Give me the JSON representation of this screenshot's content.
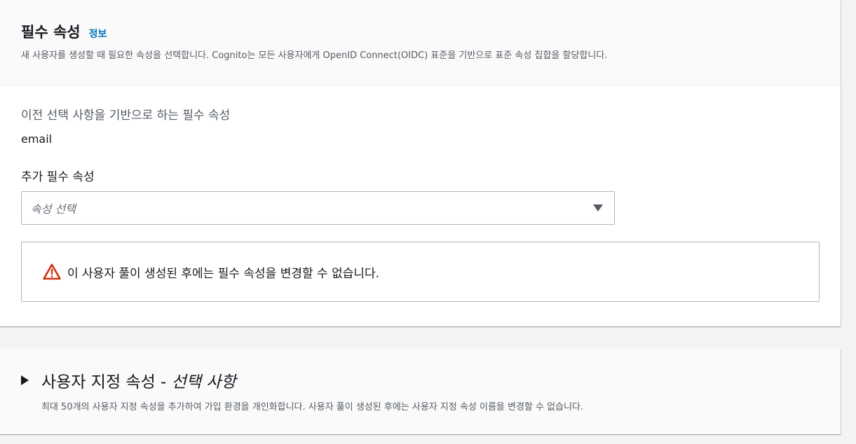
{
  "required_section": {
    "title": "필수 속성",
    "info_link": "정보",
    "description": "새 사용자를 생성할 때 필요한 속성을 선택합니다. Cognito는 모든 사용자에게 OpenID Connect(OIDC) 표준을 기반으로 표준 속성 집합을 할당합니다.",
    "previous_label": "이전 선택 사항을 기반으로 하는 필수 속성",
    "previous_value": "email",
    "additional_label": "추가 필수 속성",
    "select_placeholder": "속성 선택",
    "alert_text": "이 사용자 풀이 생성된 후에는 필수 속성을 변경할 수 없습니다.",
    "alert_icon": "warning-icon",
    "alert_color": "#d13212"
  },
  "custom_section": {
    "title_main": "사용자 지정 속성 - ",
    "title_optional": "선택 사항",
    "description": "최대 50개의 사용자 지정 속성을 추가하여 가입 환경을 개인화합니다. 사용자 풀이 생성된 후에는 사용자 지정 속성 이름을 변경할 수 없습니다.",
    "expand_icon": "caret-right-icon"
  }
}
